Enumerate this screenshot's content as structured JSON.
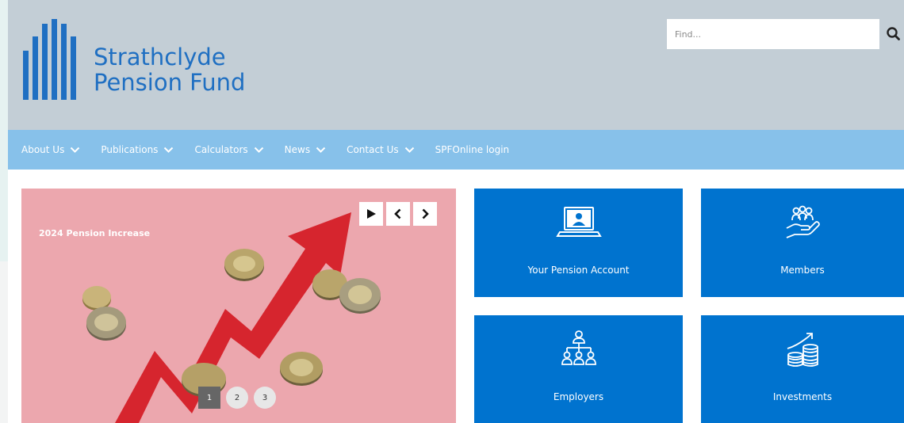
{
  "header": {
    "brand_line1": "Strathclyde",
    "brand_line2": "Pension Fund",
    "logo_icon": "spf-logo-bars-icon"
  },
  "search": {
    "placeholder": "Find...",
    "value": "",
    "icon": "search-icon"
  },
  "nav": {
    "items": [
      {
        "label": "About Us",
        "has_dropdown": true
      },
      {
        "label": "Publications",
        "has_dropdown": true
      },
      {
        "label": "Calculators",
        "has_dropdown": true
      },
      {
        "label": "News",
        "has_dropdown": true
      },
      {
        "label": "Contact Us",
        "has_dropdown": true
      },
      {
        "label": "SPFOnline login",
        "has_dropdown": false
      }
    ]
  },
  "slider": {
    "caption": "2024 Pension Increase",
    "controls": [
      "play-icon",
      "chevron-left-icon",
      "chevron-right-icon"
    ],
    "pages": [
      "1",
      "2",
      "3"
    ],
    "active_page": "1"
  },
  "tiles": [
    {
      "label": "Your Pension Account",
      "icon": "laptop-user-icon"
    },
    {
      "label": "Members",
      "icon": "hand-people-icon"
    },
    {
      "label": "Employers",
      "icon": "org-chart-icon"
    },
    {
      "label": "Investments",
      "icon": "coins-growth-icon"
    }
  ],
  "colors": {
    "brand_blue": "#1f6fc2",
    "header_bg": "#c3ced6",
    "nav_bg": "#87c1ea",
    "tile_blue": "#0073cf",
    "slide_bg": "#eca7ae",
    "arrow_red": "#d6252e"
  }
}
